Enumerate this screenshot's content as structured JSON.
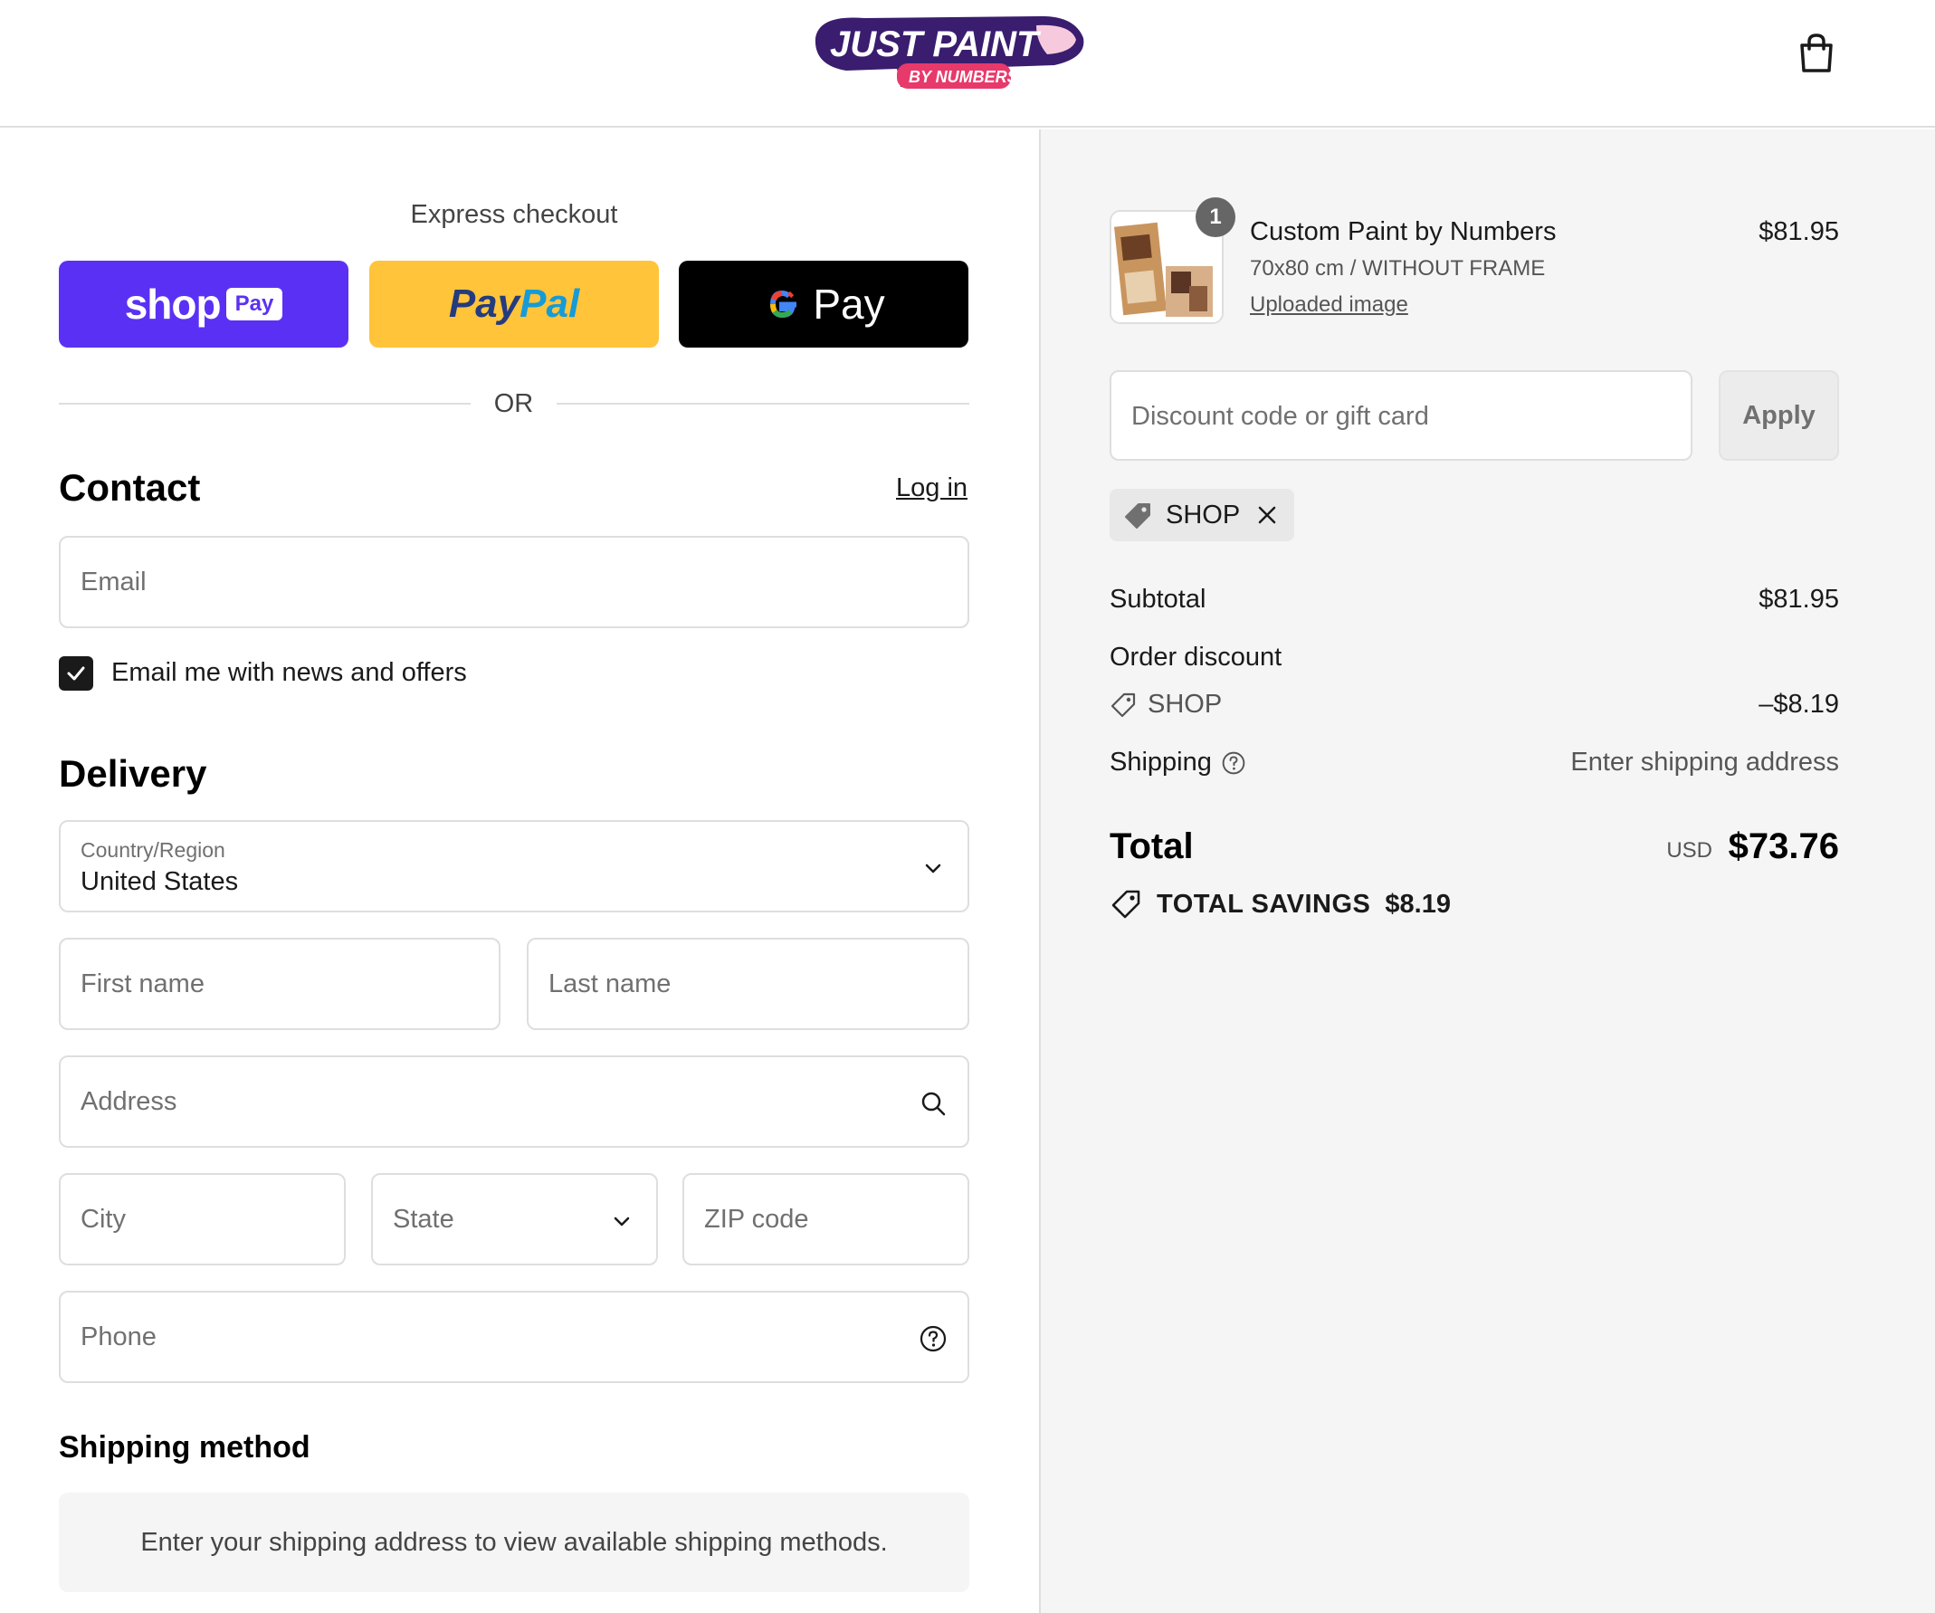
{
  "header": {
    "logo_text": "JUST PAINT",
    "logo_subtext": "BY NUMBERS",
    "cart_icon": "shopping-bag-icon"
  },
  "express": {
    "label": "Express checkout",
    "shop_pay": {
      "word": "shop",
      "pill": "Pay",
      "color": "#5a31f4"
    },
    "paypal": {
      "part1": "Pay",
      "part2": "Pal",
      "color": "#ffc439"
    },
    "gpay": {
      "word": "Pay",
      "color": "#000000"
    },
    "or": "OR"
  },
  "contact": {
    "heading": "Contact",
    "login": "Log in",
    "email_placeholder": "Email",
    "newsletter_label": "Email me with news and offers",
    "newsletter_checked": true
  },
  "delivery": {
    "heading": "Delivery",
    "country_label": "Country/Region",
    "country_value": "United States",
    "first_name": "First name",
    "last_name": "Last name",
    "address": "Address",
    "city": "City",
    "state": "State",
    "zip": "ZIP code",
    "phone": "Phone"
  },
  "shipping_method": {
    "heading": "Shipping method",
    "message": "Enter your shipping address to view available shipping methods."
  },
  "summary": {
    "item": {
      "quantity": "1",
      "title": "Custom Paint by Numbers",
      "variant": "70x80 cm / WITHOUT FRAME",
      "link": "Uploaded image",
      "price": "$81.95"
    },
    "discount_placeholder": "Discount code or gift card",
    "apply": "Apply",
    "applied_code": "SHOP",
    "subtotal_label": "Subtotal",
    "subtotal_value": "$81.95",
    "order_discount_label": "Order discount",
    "discount_code": "SHOP",
    "discount_value": "–$8.19",
    "shipping_label": "Shipping",
    "shipping_value": "Enter shipping address",
    "total_label": "Total",
    "currency": "USD",
    "total_value": "$73.76",
    "savings_label": "TOTAL SAVINGS",
    "savings_value": "$8.19"
  }
}
